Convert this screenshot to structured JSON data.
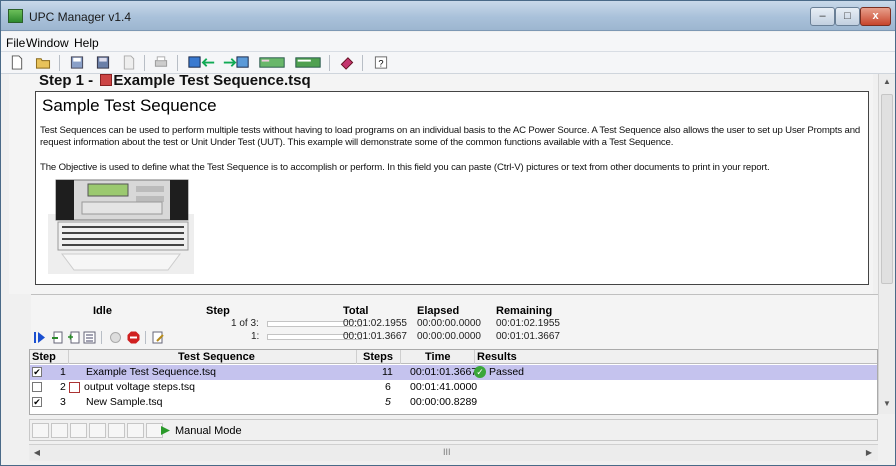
{
  "window": {
    "title": "UPC Manager v1.4",
    "controls": {
      "minimize": "–",
      "maximize": "□",
      "close": "x"
    }
  },
  "menu": [
    "File",
    "Window",
    "Help"
  ],
  "toolbar_icons": [
    "new-file-icon",
    "open-folder-icon",
    "save-icon",
    "save-as-icon",
    "disabled-file-icon",
    "print-icon",
    "export-icon",
    "import-icon",
    "sequence-icon",
    "report-icon",
    "book-icon",
    "help-icon"
  ],
  "document": {
    "step_heading": "Step 1 - ",
    "step_file": "Example Test Sequence.tsq",
    "objective_title": "Sample Test Sequence",
    "paragraph1": "Test Sequences can be used to perform multiple tests without having to load programs on an individual basis to the AC Power Source. A Test Sequence also allows the user to set up User Prompts and request information about the test or Unit Under Test (UUT). This example will demonstrate some of the common functions available with a Test Sequence.",
    "paragraph2": "The Objective is used to define what the Test Sequence is to accomplish or perform. In this field you can paste (Ctrl-V) pictures or text from other documents to print in your report."
  },
  "run_panel": {
    "status": "Idle",
    "headers": {
      "step": "Step",
      "total": "Total",
      "elapsed": "Elapsed",
      "remaining": "Remaining"
    },
    "row1": {
      "step": "1 of 3:",
      "total": "00:01:02.1955",
      "elapsed": "00:00:00.0000",
      "remaining": "00:01:02.1955",
      "progress": 0
    },
    "row2": {
      "step": "1:",
      "total": "00:01:01.3667",
      "elapsed": "00:00:00.0000",
      "remaining": "00:01:01.3667",
      "progress": 0
    }
  },
  "sequence_table": {
    "headers": {
      "step": "Step",
      "sequence": "Test Sequence",
      "steps": "Steps",
      "time": "Time",
      "results": "Results"
    },
    "rows": [
      {
        "checked": true,
        "num": "1",
        "name": "Example Test Sequence.tsq",
        "steps": "11",
        "time": "00:01:01.3667",
        "result": "Passed",
        "selected": true
      },
      {
        "checked": false,
        "num": "2",
        "name": "output voltage steps.tsq",
        "steps": "6",
        "time": "00:01:41.0000",
        "result": "",
        "selected": false
      },
      {
        "checked": true,
        "num": "3",
        "name": "New Sample.tsq",
        "steps": "5",
        "time": "00:00:00.8289",
        "result": "",
        "selected": false
      }
    ]
  },
  "statusbar": {
    "mode": "Manual Mode"
  },
  "hscroll_grip": "III",
  "colors": {
    "selected_row": "#c5c3ee",
    "passed": "#3aa63a"
  }
}
